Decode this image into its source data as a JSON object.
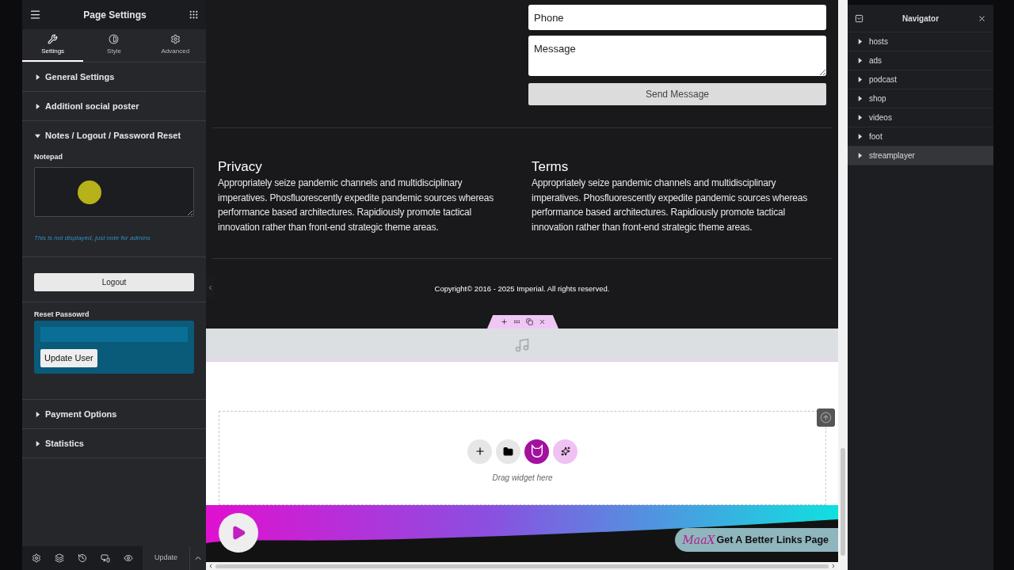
{
  "sidebar": {
    "title": "Page Settings",
    "tabs": [
      {
        "label": "Settings",
        "selected": true
      },
      {
        "label": "Style",
        "selected": false
      },
      {
        "label": "Advanced",
        "selected": false
      }
    ],
    "sections": [
      {
        "title": "General Settings",
        "expanded": false
      },
      {
        "title": "Additionl social poster",
        "expanded": false
      },
      {
        "title": "Notes / Logout / Password Reset",
        "expanded": true,
        "notepad_label": "Notepad",
        "hint": "This is not displayed, just note for admins",
        "logout": "Logout",
        "reset_label": "Reset Passowrd",
        "update_button": "Update User"
      },
      {
        "title": "Payment Options",
        "expanded": false
      },
      {
        "title": "Statistics",
        "expanded": false
      }
    ],
    "footer": {
      "update": "Update"
    }
  },
  "canvas": {
    "form": {
      "phone_placeholder": "Phone",
      "message_placeholder": "Message",
      "send": "Send Message"
    },
    "columns": [
      {
        "heading": "Privacy",
        "body": "Appropriately seize pandemic channels and multidisciplinary imperatives. Phosfluorescently expedite pandemic sources whereas performance based architectures. Rapidiously promote tactical innovation rather than front-end strategic theme areas."
      },
      {
        "heading": "Terms",
        "body": "Appropriately seize pandemic channels and multidisciplinary imperatives. Phosfluorescently expedite pandemic sources whereas performance based architectures. Rapidiously promote tactical innovation rather than front-end strategic theme areas."
      }
    ],
    "copyright": "Copyright© 2016 - 2025 Imperial. All rights reserved.",
    "drop_hint": "Drag widget here",
    "banner": {
      "logo": "MaaX",
      "text": "Get A Better Links Page"
    }
  },
  "navigator": {
    "title": "Navigator",
    "items": [
      {
        "label": "hosts",
        "selected": false
      },
      {
        "label": "ads",
        "selected": false
      },
      {
        "label": "podcast",
        "selected": false
      },
      {
        "label": "shop",
        "selected": false
      },
      {
        "label": "videos",
        "selected": false
      },
      {
        "label": "foot",
        "selected": false
      },
      {
        "label": "streamplayer",
        "selected": true
      }
    ]
  }
}
